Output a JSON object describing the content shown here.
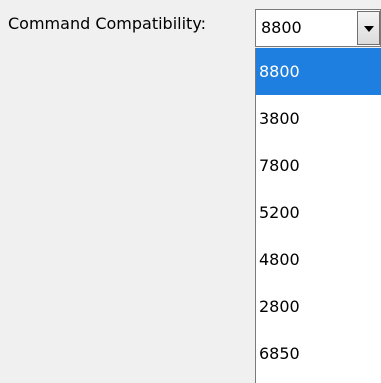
{
  "form": {
    "label": "Command Compatibility:",
    "selected_value": "8800",
    "dropdown_arrow_icon": "chevron-down-icon"
  },
  "dropdown": {
    "options": [
      "8800",
      "3800",
      "7800",
      "5200",
      "4800",
      "2800",
      "6850"
    ],
    "highlighted_index": 0,
    "highlight_color": "#1e7fe0"
  }
}
